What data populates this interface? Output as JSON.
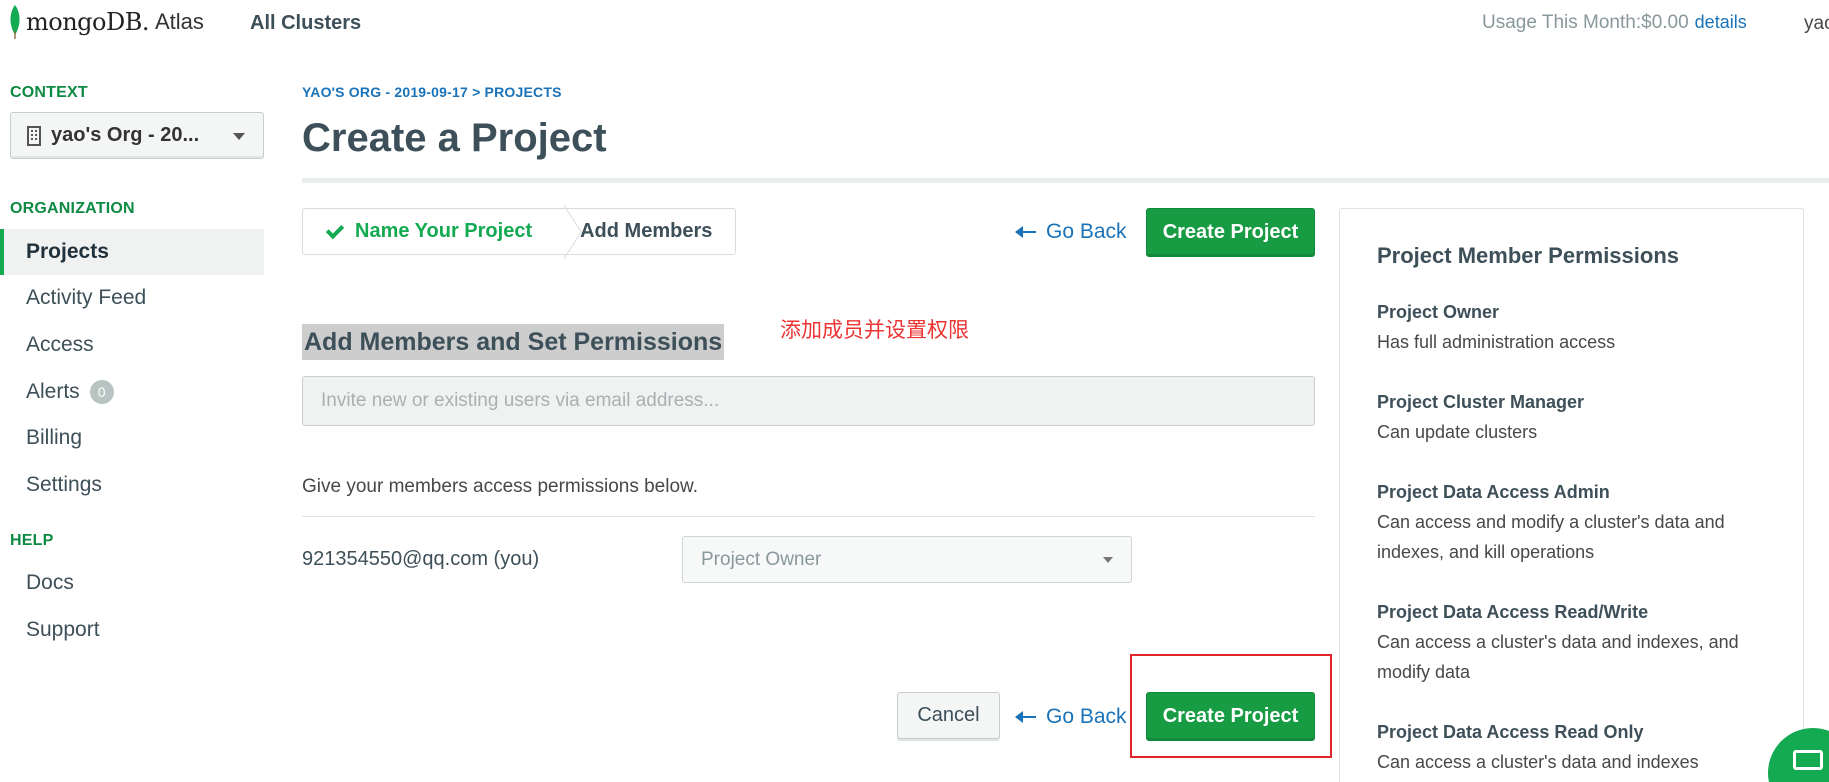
{
  "header": {
    "logo_text": "mongoDB.",
    "logo_product": "Atlas",
    "all_clusters": "All Clusters",
    "usage_label": "Usage This Month:",
    "usage_value": "$0.00",
    "details_link": "details",
    "user_short": "yao"
  },
  "sidebar": {
    "context_heading": "CONTEXT",
    "context_value": "yao's Org - 20...",
    "organization_heading": "ORGANIZATION",
    "org_items": [
      {
        "label": "Projects",
        "active": true
      },
      {
        "label": "Activity Feed"
      },
      {
        "label": "Access"
      },
      {
        "label": "Alerts",
        "badge": "0"
      },
      {
        "label": "Billing"
      },
      {
        "label": "Settings"
      }
    ],
    "help_heading": "HELP",
    "help_items": [
      {
        "label": "Docs"
      },
      {
        "label": "Support"
      }
    ]
  },
  "main": {
    "breadcrumb": {
      "org": "YAO'S ORG - 2019-09-17",
      "separator": ">",
      "section": "PROJECTS"
    },
    "title": "Create a Project",
    "steps": [
      {
        "label": "Name Your Project",
        "completed": true
      },
      {
        "label": "Add Members",
        "completed": false
      }
    ],
    "go_back_label": "Go Back",
    "create_project_label": "Create Project",
    "cancel_label": "Cancel",
    "section_title": "Add Members and Set Permissions",
    "annotation": "添加成员并设置权限",
    "invite_placeholder": "Invite new or existing users via email address...",
    "permissions_hint": "Give your members access permissions below.",
    "member": {
      "email": "921354550@qq.com (you)",
      "role": "Project Owner"
    }
  },
  "permissions_panel": {
    "title": "Project Member Permissions",
    "items": [
      {
        "name": "Project Owner",
        "desc": "Has full administration access"
      },
      {
        "name": "Project Cluster Manager",
        "desc": "Can update clusters"
      },
      {
        "name": "Project Data Access Admin",
        "desc": "Can access and modify a cluster's data and indexes, and kill operations"
      },
      {
        "name": "Project Data Access Read/Write",
        "desc": "Can access a cluster's data and indexes, and modify data"
      },
      {
        "name": "Project Data Access Read Only",
        "desc": "Can access a cluster's data and indexes"
      }
    ]
  },
  "colors": {
    "brand_green": "#13aa52",
    "link_blue": "#1a73b8",
    "annotation_red": "#e0262c"
  }
}
